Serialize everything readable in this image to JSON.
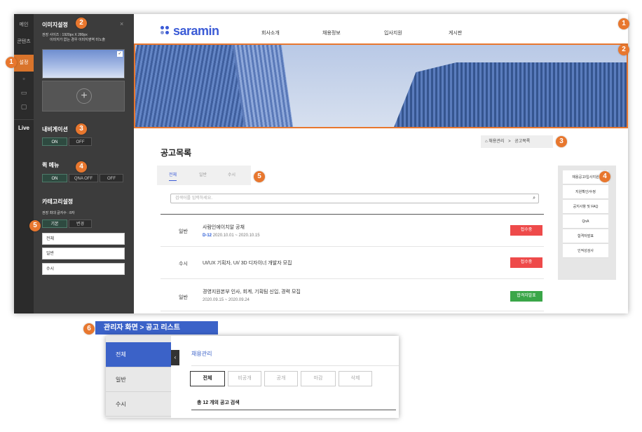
{
  "rail": {
    "items": [
      "메인",
      "콘텐츠",
      "설정"
    ],
    "live": "Live"
  },
  "panel": {
    "image_title": "이미지설정",
    "image_note1": "권장 사이즈 : 1920px X 280px",
    "image_note2": "이미지가 없는 경우 이미지영역 미노출",
    "nav_title": "내비게이션",
    "nav_on": "ON",
    "nav_off": "OFF",
    "quick_title": "퀵 메뉴",
    "quick_on": "ON",
    "quick_qna_off": "QNA OFF",
    "quick_off": "OFF",
    "cat_title": "카테고리설정",
    "cat_note": "권장 최대 글자수 : 8자",
    "cat_basic": "기본",
    "cat_change": "변경",
    "cat_items": [
      "전체",
      "일반",
      "수시"
    ],
    "close": "×"
  },
  "site": {
    "logo": "saramin",
    "nav": [
      "회사소개",
      "채용정보",
      "입사지원",
      "게시판"
    ],
    "breadcrumb_home": "채용관리",
    "breadcrumb_sep": ">",
    "breadcrumb_current": "공고목록",
    "page_title": "공고목록",
    "tabs": [
      "전체",
      "일반",
      "수시"
    ],
    "search_placeholder": "검색어를 입력하세요.",
    "rows": [
      {
        "cat": "일반",
        "title": "사람인에이치알 공채",
        "dday": "D-12",
        "date": "2020.10.01 ~ 2020.10.15",
        "btn": "접수중",
        "color": "#ee4a4a"
      },
      {
        "cat": "수시",
        "title": "UI/UX 기획자, UI/ 3D 디자이너 개발자 모집",
        "dday": "",
        "date": "",
        "btn": "접수중",
        "color": "#ee4a4a"
      },
      {
        "cat": "일반",
        "title": "경영지원본부 인사, 회계, 기획팀 신입, 경력 모집",
        "dday": "",
        "date": "2020.09.15 ~ 2020.09.24",
        "btn": "합격자발표",
        "color": "#3aa648"
      }
    ],
    "quick": [
      "채용공고/입사지원",
      "지원확인/수정",
      "공지사항 및 FAQ",
      "QnA",
      "합격자발표",
      "인적성검사"
    ]
  },
  "badges": [
    "1",
    "2",
    "3",
    "4",
    "5",
    "6"
  ],
  "section_label": "관리자 화면 > 공고 리스트",
  "admin": {
    "sidebar": [
      "전체",
      "일반",
      "수시"
    ],
    "collapse": "‹",
    "title": "채용관리",
    "tabs": [
      "전체",
      "비공개",
      "공개",
      "마감",
      "삭제"
    ],
    "count": "총 12 개의 공고 검색"
  },
  "colors": {
    "accent": "#e8772e",
    "brand": "#3b5bd6",
    "admin_blue": "#3b62c8"
  }
}
